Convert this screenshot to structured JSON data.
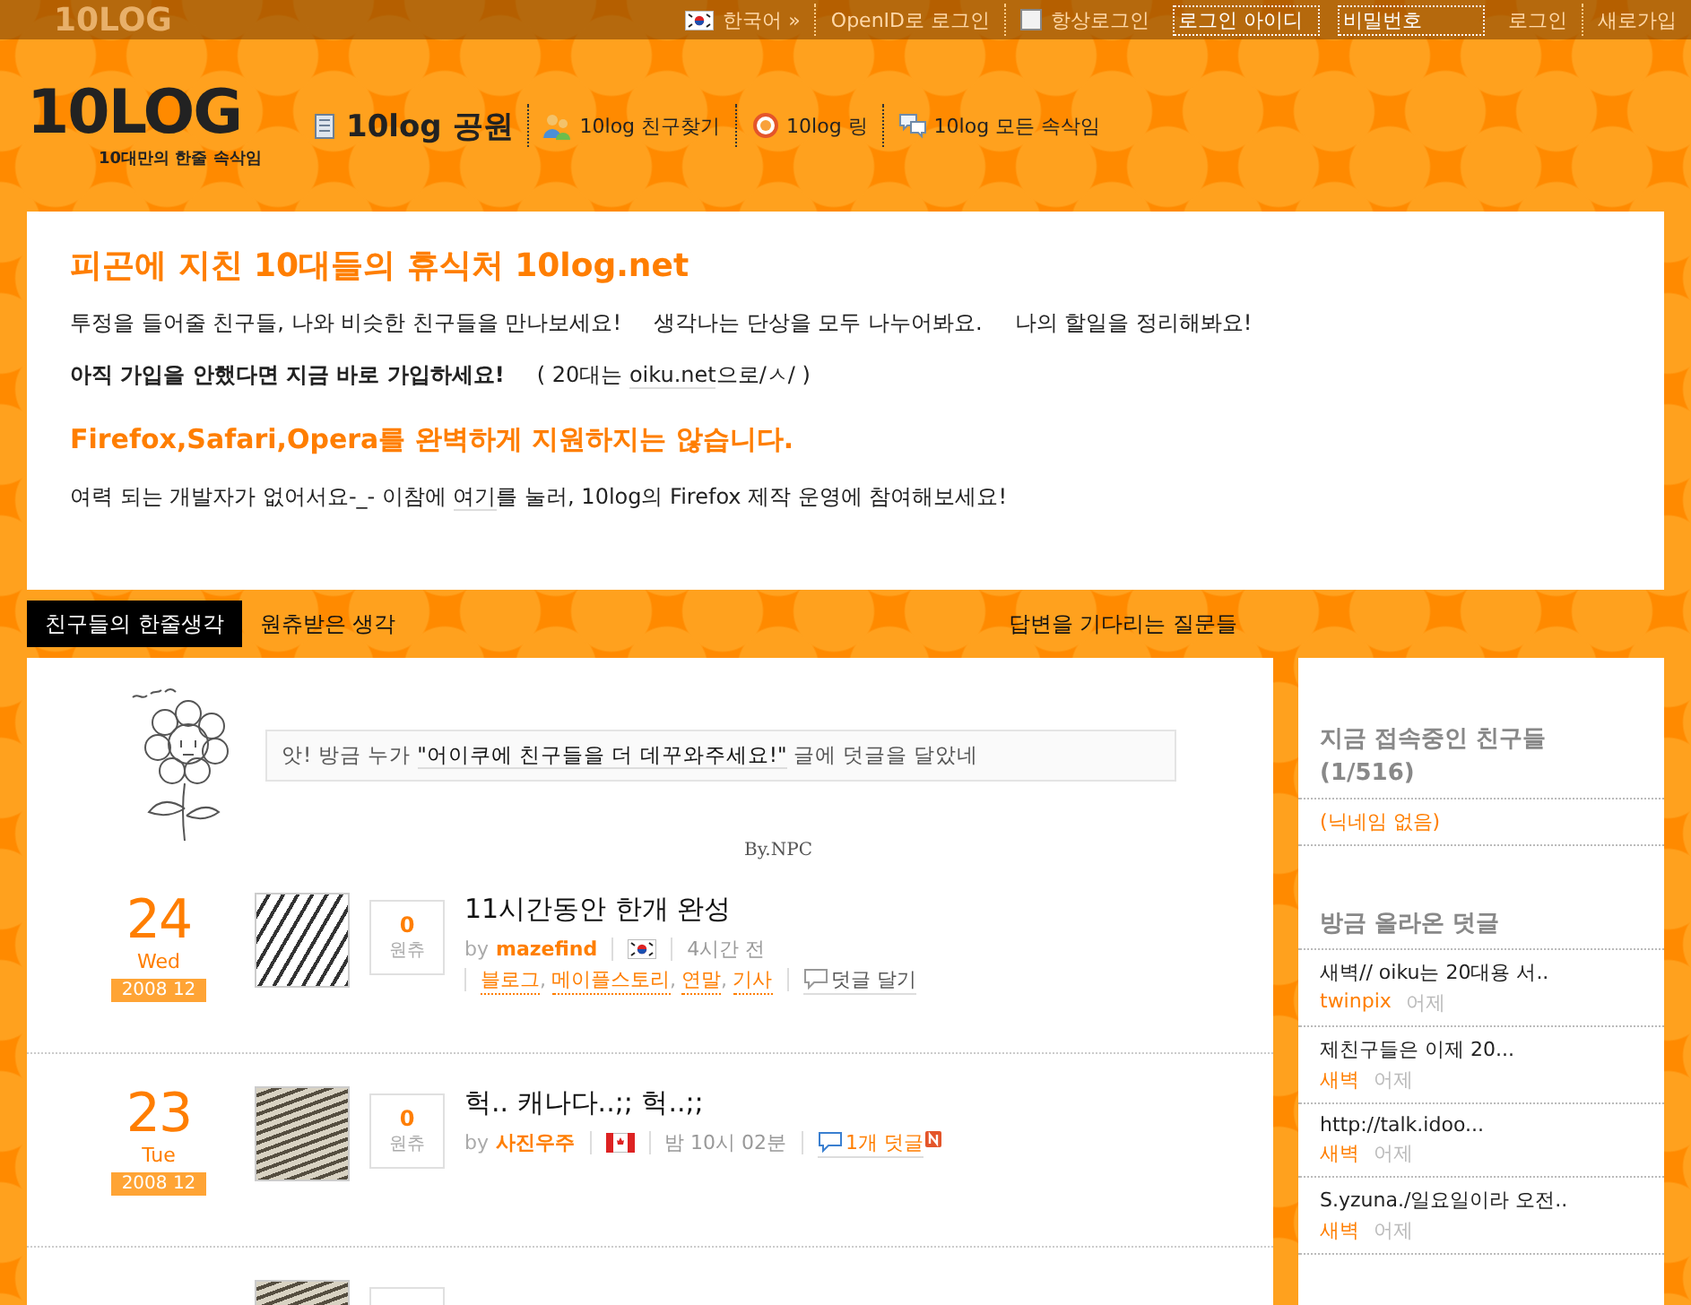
{
  "topbar": {
    "logo": "10LOG",
    "language": "한국어 »",
    "openid_login": "OpenID로 로그인",
    "remember": {
      "label": "항상로그인",
      "checked": false
    },
    "login_id": {
      "placeholder": "로그인 아이디"
    },
    "password": {
      "placeholder": "비밀번호"
    },
    "login": "로그인",
    "signup": "새로가입"
  },
  "header": {
    "logo": "10LOG",
    "tagline": "10대만의 한줄 속삭임",
    "nav": [
      {
        "kind": "park",
        "label": "10log 공원",
        "selected": true
      },
      {
        "kind": "friends",
        "label": "10log 친구찾기",
        "selected": false
      },
      {
        "kind": "ring",
        "label": "10log 링",
        "selected": false
      },
      {
        "kind": "whispers",
        "label": "10log 모든 속삭임",
        "selected": false
      }
    ]
  },
  "intro": {
    "title": "피곤에 지친 10대들의 휴식처 10log.net",
    "lines": [
      "투정을 들어줄 친구들, 나와 비슷한 친구들을 만나보세요!",
      "생각나는 단상을 모두 나누어봐요.",
      "나의 할일을 정리해봐요!"
    ],
    "join": "아직 가입을 안했다면 지금 바로 가입하세요!",
    "twenties_before": "( 20대는 ",
    "twenties_link": "oiku.net",
    "twenties_after": "으로/ㅅ/ )",
    "warning": "Firefox,Safari,Opera를 완벽하게 지원하지는 않습니다.",
    "help_before": "여력 되는 개발자가 없어서요-_- 이참에 ",
    "help_link": "여기",
    "help_after": "를 눌러, 10log의 Firefox 제작 운영에 참여해보세요!"
  },
  "tabs": [
    {
      "label": "친구들의 한줄생각",
      "selected": true
    },
    {
      "label": "원츄받은 생각",
      "selected": false
    },
    {
      "label": "답변을 기다리는 질문들",
      "selected": false
    }
  ],
  "notice": {
    "before": "앗! 방금 누가 ",
    "link": "\"어이쿠에 친구들을 더 데꾸와주세요!\"",
    "after": " 글에 덧글을 달았네",
    "signature": "By.NPC"
  },
  "posts": [
    {
      "day": "24",
      "weekday": "Wed",
      "month": "2008 12",
      "wants": "0",
      "wants_label": "원츄",
      "title": "11시간동안 한개 완성",
      "by": "by",
      "author": "mazefind",
      "flag": {
        "kind": "kr"
      },
      "time": "4시간 전",
      "tags": [
        "블로그",
        "메이플스토리",
        "연말",
        "기사"
      ],
      "tag_separator": ",",
      "comments": "덧글 달기",
      "new": false
    },
    {
      "day": "23",
      "weekday": "Tue",
      "month": "2008 12",
      "wants": "0",
      "wants_label": "원츄",
      "title": "헉.. 캐나다..;; 헉..;;",
      "by": "by",
      "author": "사진우주",
      "flag": {
        "kind": "ca"
      },
      "time": "밤 10시 02분",
      "comments": "1개 덧글",
      "new": true
    }
  ],
  "sidebar": {
    "online_title": "지금 접속중인 친구들",
    "online_count": "(1/516)",
    "online_users": [
      "(닉네임 없음)"
    ],
    "recent_title": "방금 올라온 덧글",
    "recent": [
      {
        "text": "새벽// oiku는 20대용 서..",
        "author": "twinpix",
        "time": "어제"
      },
      {
        "text": "제친구들은 이제 20...",
        "author": "새벽",
        "time": "어제"
      },
      {
        "text": "http://talk.idoo...",
        "author": "새벽",
        "time": "어제"
      },
      {
        "text": "S.yzuna./일요일이라 오전..",
        "author": "새벽",
        "time": "어제"
      }
    ]
  }
}
